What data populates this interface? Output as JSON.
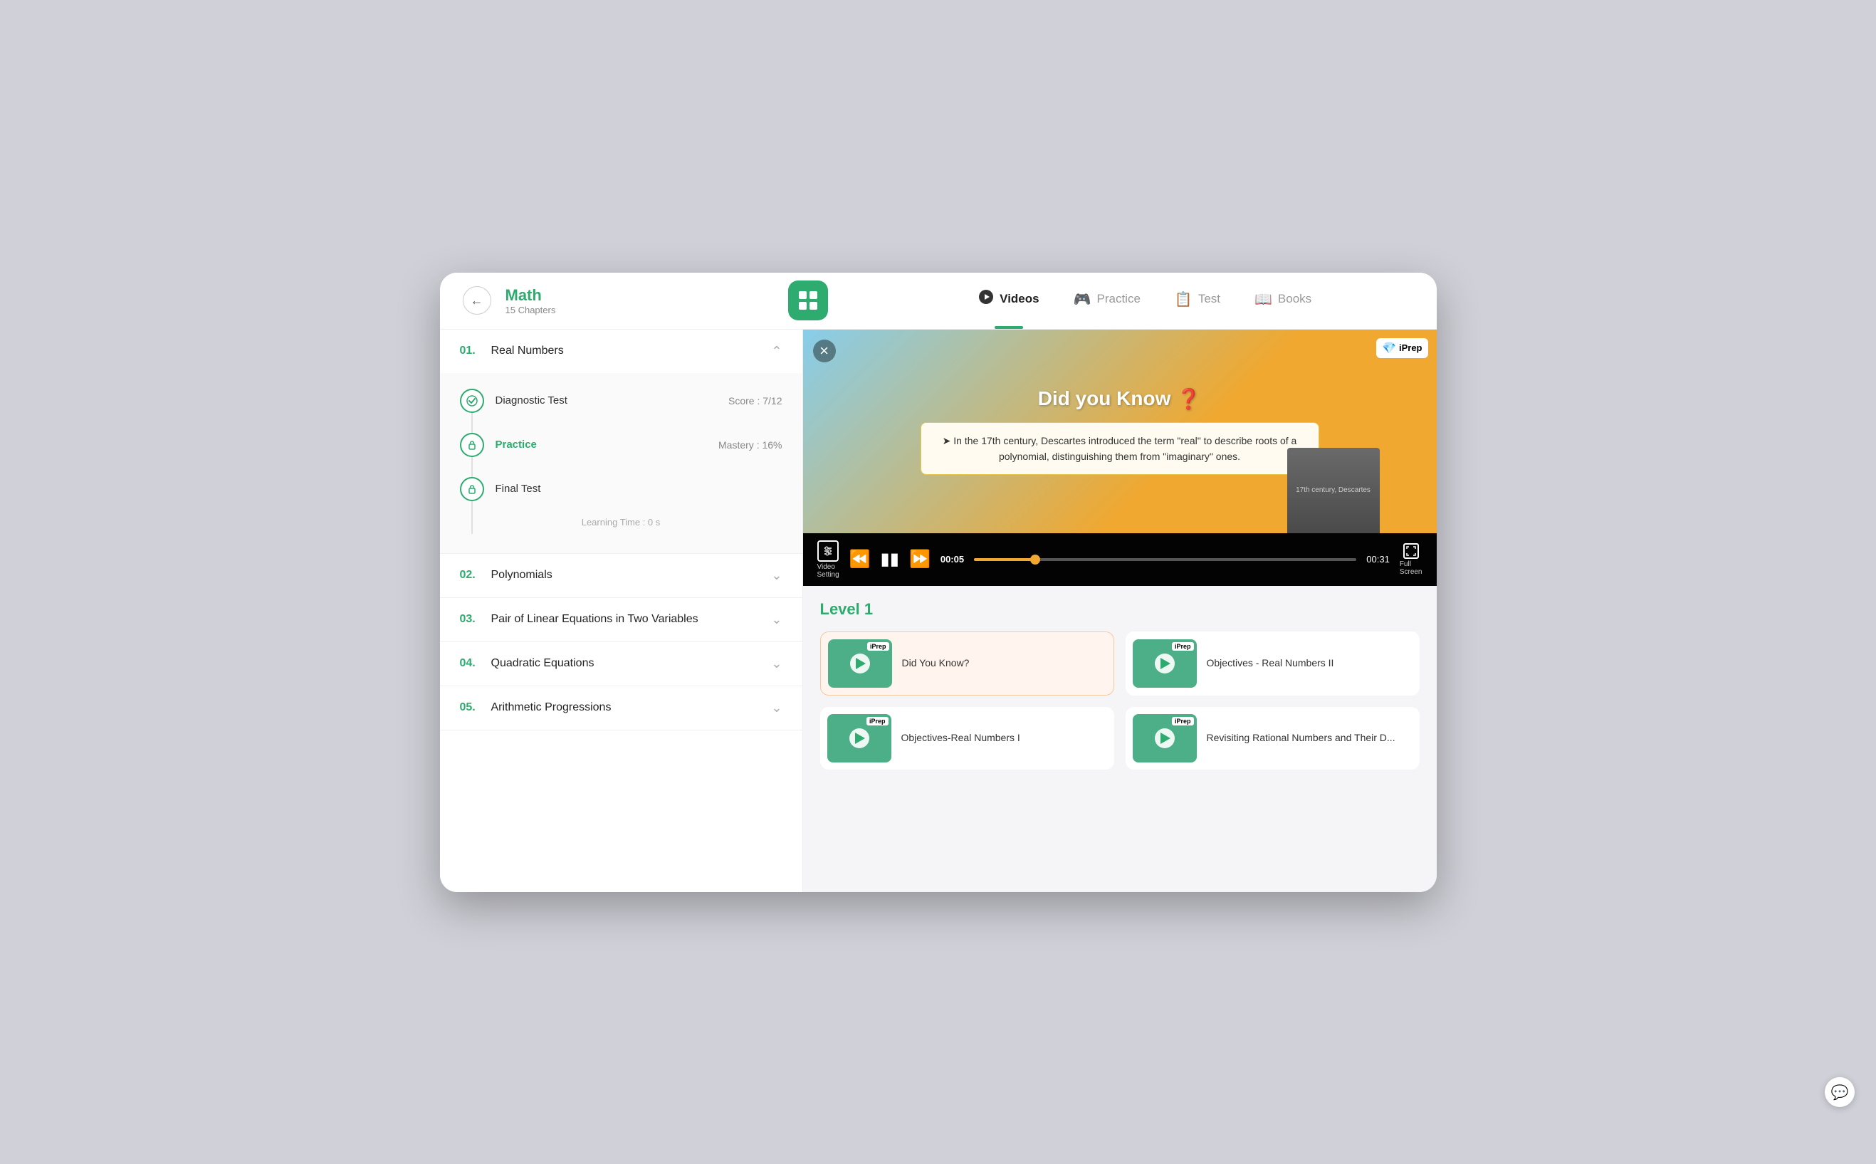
{
  "window": {
    "subject": "Math",
    "chapters_count": "15 Chapters"
  },
  "nav": {
    "tabs": [
      {
        "id": "videos",
        "label": "Videos",
        "active": true,
        "icon": "▶"
      },
      {
        "id": "practice",
        "label": "Practice",
        "active": false,
        "icon": "🎮"
      },
      {
        "id": "test",
        "label": "Test",
        "active": false,
        "icon": "📋"
      },
      {
        "id": "books",
        "label": "Books",
        "active": false,
        "icon": "📖"
      }
    ]
  },
  "sidebar": {
    "chapters": [
      {
        "num": "01.",
        "name": "Real Numbers",
        "expanded": true,
        "sub_items": [
          {
            "label": "Diagnostic Test",
            "score": "Score : 7/12",
            "icon": "check",
            "completed": true
          },
          {
            "label": "Practice",
            "score": "Mastery : 16%",
            "icon": "lock",
            "active": true
          },
          {
            "label": "Final Test",
            "score": "",
            "icon": "lock",
            "active": false
          }
        ],
        "learning_time": "Learning Time : 0 s"
      },
      {
        "num": "02.",
        "name": "Polynomials",
        "expanded": false
      },
      {
        "num": "03.",
        "name": "Pair of Linear Equations in Two Variables",
        "expanded": false
      },
      {
        "num": "04.",
        "name": "Quadratic Equations",
        "expanded": false
      },
      {
        "num": "05.",
        "name": "Arithmetic Progressions",
        "expanded": false
      }
    ]
  },
  "video_player": {
    "close_label": "×",
    "iprep_badge": "iPrep",
    "did_you_know_title": "Did you Know",
    "did_you_know_emoji": "❓",
    "info_text": "➤  In the 17th century, Descartes introduced the term \"real\" to describe roots of a polynomial, distinguishing them from \"imaginary\" ones.",
    "century_label": "17th century, Descartes",
    "setting_label": "Video\nSetting",
    "time_current": "00:05",
    "time_total": "00:31",
    "fullscreen_label": "Full\nScreen",
    "progress_pct": 16
  },
  "content": {
    "level_title": "Level 1",
    "videos": [
      {
        "label": "Did You Know?",
        "active": true,
        "iprep": "iPrep"
      },
      {
        "label": "Objectives - Real Numbers II",
        "active": false,
        "iprep": "iPrep"
      },
      {
        "label": "Objectives-Real Numbers I",
        "active": false,
        "iprep": "iPrep"
      },
      {
        "label": "Revisiting Rational Numbers and Their D...",
        "active": false,
        "iprep": "iPrep"
      }
    ]
  }
}
